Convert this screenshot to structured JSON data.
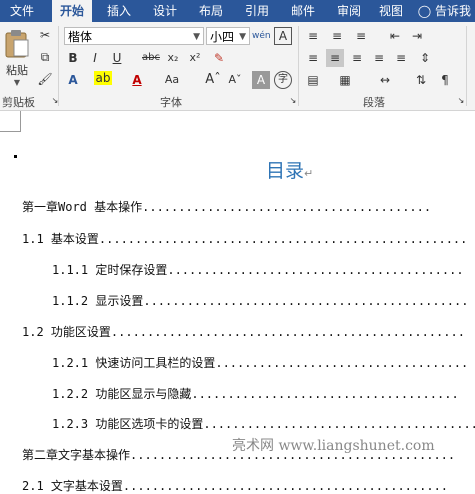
{
  "tabs": [
    "文件",
    "开始",
    "插入",
    "设计",
    "布局",
    "引用",
    "邮件",
    "审阅",
    "视图"
  ],
  "tell_me": "告诉我",
  "clipboard": {
    "paste_label": "粘贴",
    "group_label": "剪贴板"
  },
  "font": {
    "name": "楷体",
    "size": "小四",
    "group_label": "字体"
  },
  "paragraph": {
    "group_label": "段落"
  },
  "document": {
    "title": "目录",
    "toc": [
      {
        "text": "第一章Word 基本操作",
        "level": 0
      },
      {
        "text": "1.1 基本设置",
        "level": 0
      },
      {
        "text": "1.1.1 定时保存设置",
        "level": 1
      },
      {
        "text": "1.1.2 显示设置",
        "level": 1
      },
      {
        "text": "1.2 功能区设置",
        "level": 0
      },
      {
        "text": "1.2.1 快速访问工具栏的设置",
        "level": 1
      },
      {
        "text": "1.2.2 功能区显示与隐藏",
        "level": 1
      },
      {
        "text": "1.2.3 功能区选项卡的设置",
        "level": 1
      },
      {
        "text": "第二章文字基本操作",
        "level": 0
      },
      {
        "text": "2.1 文字基本设置",
        "level": 0
      }
    ]
  },
  "watermark": "亮术网 www.liangshunet.com",
  "colors": {
    "tabbar": "#2b579a",
    "title": "#2e74b5"
  }
}
